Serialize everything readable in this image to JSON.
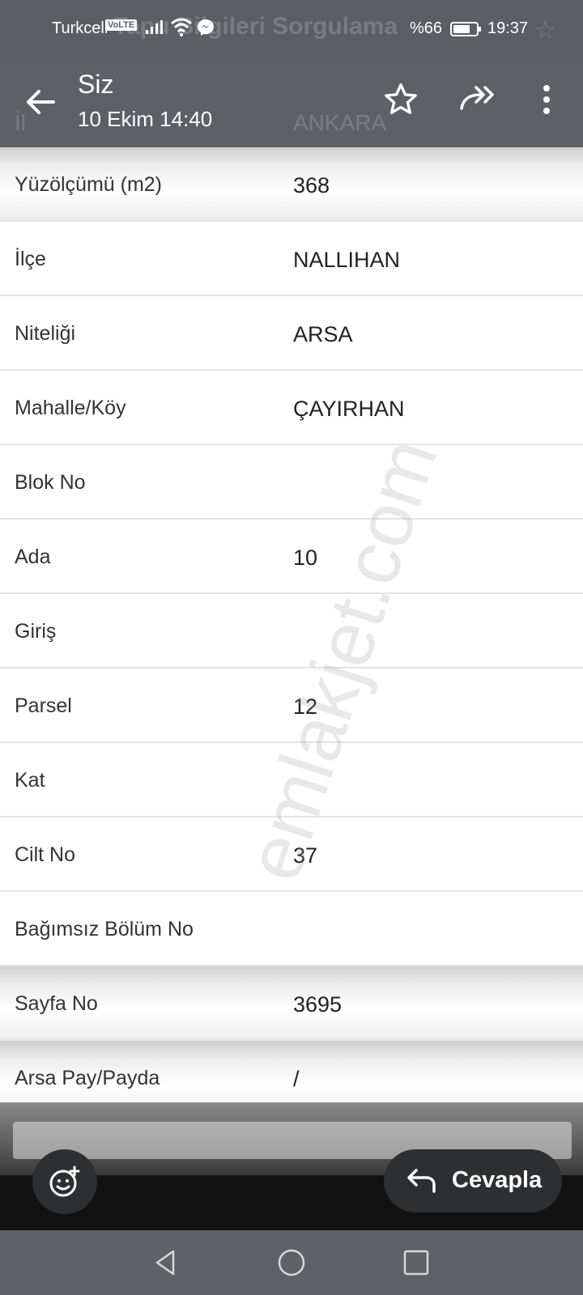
{
  "status_bar": {
    "carrier": "Turkcell",
    "volte": "VoLTE",
    "battery": "%66",
    "time": "19:37",
    "background_title": "Tapu Bilgileri Sorgulama",
    "icons": [
      "signal-icon",
      "wifi-icon",
      "messenger-icon",
      "battery-icon"
    ]
  },
  "header": {
    "sender": "Siz",
    "timestamp": "10 Ekim 14:40",
    "background_row": {
      "key": "İl",
      "value": "ANKARA"
    },
    "actions": [
      "back-arrow-icon",
      "star-icon",
      "forward-icon",
      "more-vert-icon"
    ]
  },
  "table": {
    "rows": [
      {
        "key": "Yüzölçümü (m2)",
        "value": "368"
      },
      {
        "key": "İlçe",
        "value": "NALLIHAN"
      },
      {
        "key": "Niteliği",
        "value": "ARSA"
      },
      {
        "key": "Mahalle/Köy",
        "value": "ÇAYIRHAN"
      },
      {
        "key": "Blok No",
        "value": ""
      },
      {
        "key": "Ada",
        "value": "10"
      },
      {
        "key": "Giriş",
        "value": ""
      },
      {
        "key": "Parsel",
        "value": "12"
      },
      {
        "key": "Kat",
        "value": ""
      },
      {
        "key": "Cilt No",
        "value": "37"
      },
      {
        "key": "Bağımsız Bölüm No",
        "value": ""
      },
      {
        "key": "Sayfa No",
        "value": "3695"
      },
      {
        "key": "Arsa Pay/Payda",
        "value": "/"
      }
    ]
  },
  "watermark": "emlakjet.com",
  "bottom": {
    "reply_label": "Cevapla",
    "icons": [
      "emoji-add-icon",
      "reply-icon"
    ]
  },
  "navbar": {
    "icons": [
      "nav-back-icon",
      "nav-home-icon",
      "nav-recents-icon"
    ]
  },
  "colors": {
    "bar": "#5d6165",
    "table_bg": "#ffffff",
    "divider": "#e4e4e4",
    "bottom_bar": "#121212",
    "button_bg": "#2d2f31"
  }
}
